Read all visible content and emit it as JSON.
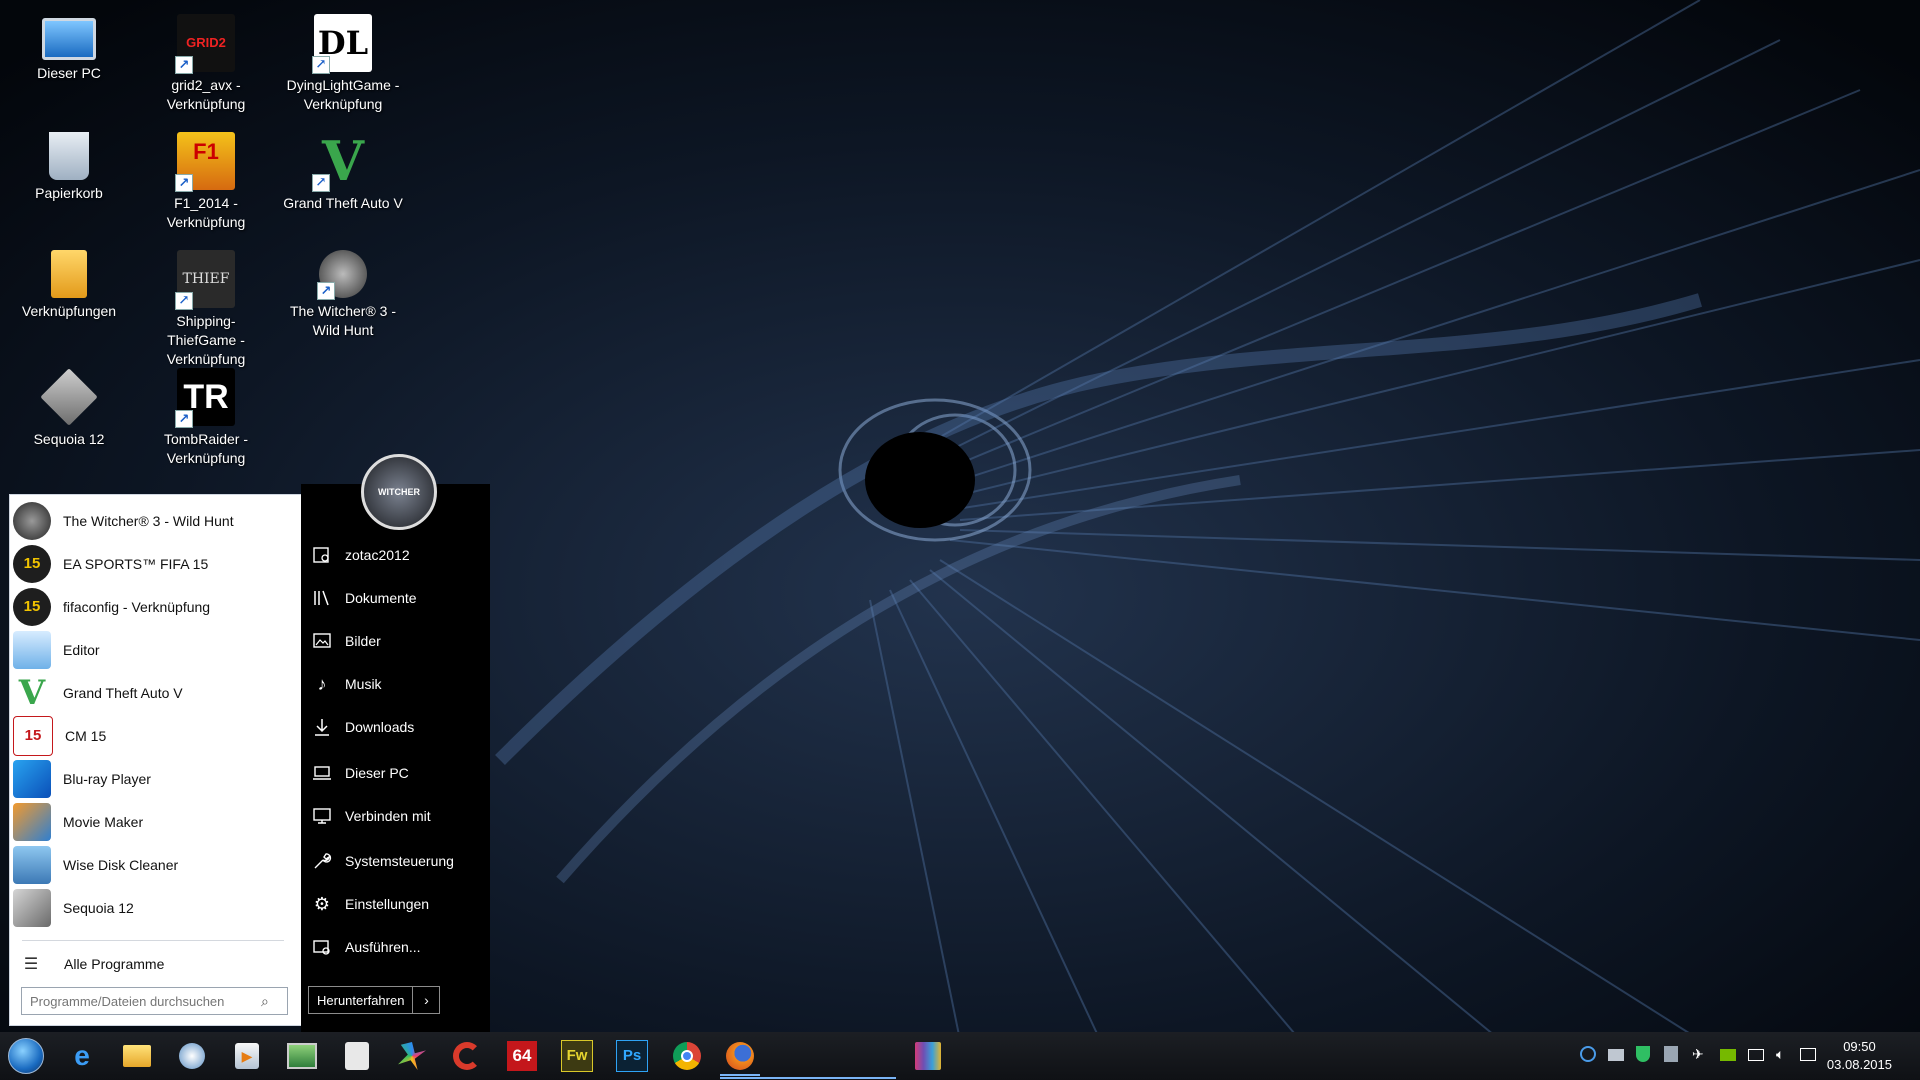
{
  "desktop_icons": [
    {
      "label": "Dieser PC",
      "icon": "monitor-icon"
    },
    {
      "label": "grid2_avx - Verknüpfung",
      "icon": "grid2-icon",
      "text": "GRID2"
    },
    {
      "label": "DyingLightGame - Verknüpfung",
      "icon": "dyinglight-icon",
      "text": "DL"
    },
    {
      "label": "Papierkorb",
      "icon": "recycle-bin-icon"
    },
    {
      "label": "F1_2014 - Verknüpfung",
      "icon": "f1-2014-icon",
      "text": "F1"
    },
    {
      "label": "Grand Theft Auto V",
      "icon": "gta5-icon",
      "text": "V"
    },
    {
      "label": "Verknüpfungen",
      "icon": "folder-icon"
    },
    {
      "label": "Shipping-ThiefGame - Verknüpfung",
      "icon": "thief-icon",
      "text": "THIEF"
    },
    {
      "label": "The Witcher® 3 - Wild Hunt",
      "icon": "witcher-icon"
    },
    {
      "label": "Sequoia 12",
      "icon": "sequoia-icon"
    },
    {
      "label": "TombRaider - Verknüpfung",
      "icon": "tombraider-icon",
      "text": "TR"
    }
  ],
  "start_menu": {
    "programs": [
      {
        "label": "The Witcher® 3 - Wild Hunt",
        "icon": "witcher-icon"
      },
      {
        "label": "EA SPORTS™ FIFA 15",
        "icon": "fifa15-icon",
        "badge": "15"
      },
      {
        "label": "fifaconfig - Verknüpfung",
        "icon": "fifaconfig-icon",
        "badge": "15"
      },
      {
        "label": "Editor",
        "icon": "notepad-icon"
      },
      {
        "label": "Grand Theft Auto V",
        "icon": "gta5-icon",
        "badge": "V"
      },
      {
        "label": "CM 15",
        "icon": "cm15-icon",
        "badge": "15"
      },
      {
        "label": "Blu-ray Player",
        "icon": "bluray-icon"
      },
      {
        "label": "Movie Maker",
        "icon": "movie-maker-icon"
      },
      {
        "label": "Wise Disk Cleaner",
        "icon": "wise-disk-cleaner-icon"
      },
      {
        "label": "Sequoia 12",
        "icon": "sequoia-icon"
      }
    ],
    "all_programs": "Alle Programme",
    "search_placeholder": "Programme/Dateien durchsuchen",
    "places": [
      {
        "label": "zotac2012",
        "icon": "user-folder-icon"
      },
      {
        "label": "Dokumente",
        "icon": "documents-icon"
      },
      {
        "label": "Bilder",
        "icon": "pictures-icon"
      },
      {
        "label": "Musik",
        "icon": "music-icon"
      },
      {
        "label": "Downloads",
        "icon": "download-icon"
      },
      {
        "label": "Dieser PC",
        "icon": "computer-icon"
      },
      {
        "label": "Verbinden mit",
        "icon": "connect-icon"
      },
      {
        "label": "Systemsteuerung",
        "icon": "control-panel-icon"
      },
      {
        "label": "Einstellungen",
        "icon": "gear-icon"
      },
      {
        "label": "Ausführen...",
        "icon": "run-icon"
      }
    ],
    "shutdown_label": "Herunterfahren",
    "avatar_text": "WITCHER"
  },
  "taskbar": {
    "apps": [
      {
        "name": "edge",
        "icon": "edge-icon"
      },
      {
        "name": "explorer",
        "icon": "file-explorer-icon"
      },
      {
        "name": "disk-utility",
        "icon": "disk-icon"
      },
      {
        "name": "media-player",
        "icon": "media-player-icon"
      },
      {
        "name": "image-viewer",
        "icon": "image-viewer-icon"
      },
      {
        "name": "calculator",
        "icon": "calculator-icon"
      },
      {
        "name": "app-colorful",
        "icon": "pinwheel-icon"
      },
      {
        "name": "ccleaner",
        "icon": "ccleaner-icon"
      },
      {
        "name": "aida64",
        "icon": "aida64-icon",
        "text": "64"
      },
      {
        "name": "fireworks",
        "icon": "fireworks-icon",
        "text": "Fw"
      },
      {
        "name": "photoshop",
        "icon": "photoshop-icon",
        "text": "Ps"
      },
      {
        "name": "chrome",
        "icon": "chrome-icon"
      },
      {
        "name": "firefox",
        "icon": "firefox-icon"
      },
      {
        "name": "winrar",
        "icon": "winrar-icon"
      }
    ],
    "time": "09:50",
    "date": "03.08.2015"
  }
}
